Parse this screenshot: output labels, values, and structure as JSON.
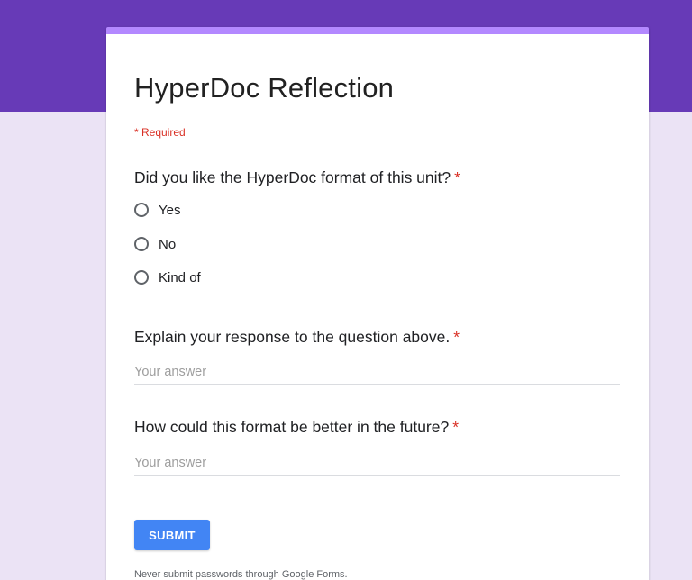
{
  "theme": {
    "header_color": "#673ab7",
    "accent_color": "#b388ff",
    "background_color": "#ebe3f5",
    "button_color": "#4285f4",
    "required_color": "#d93025"
  },
  "form": {
    "title": "HyperDoc Reflection",
    "required_note": "* Required"
  },
  "questions": [
    {
      "title": "Did you like the HyperDoc format of this unit?",
      "required_marker": "*",
      "type": "radio",
      "options": [
        "Yes",
        "No",
        "Kind of"
      ]
    },
    {
      "title": "Explain your response to the question above.",
      "required_marker": "*",
      "type": "short_text",
      "placeholder": "Your answer"
    },
    {
      "title": "How could this format be better in the future?",
      "required_marker": "*",
      "type": "short_text",
      "placeholder": "Your answer"
    }
  ],
  "actions": {
    "submit_label": "SUBMIT"
  },
  "footer": {
    "note": "Never submit passwords through Google Forms."
  }
}
